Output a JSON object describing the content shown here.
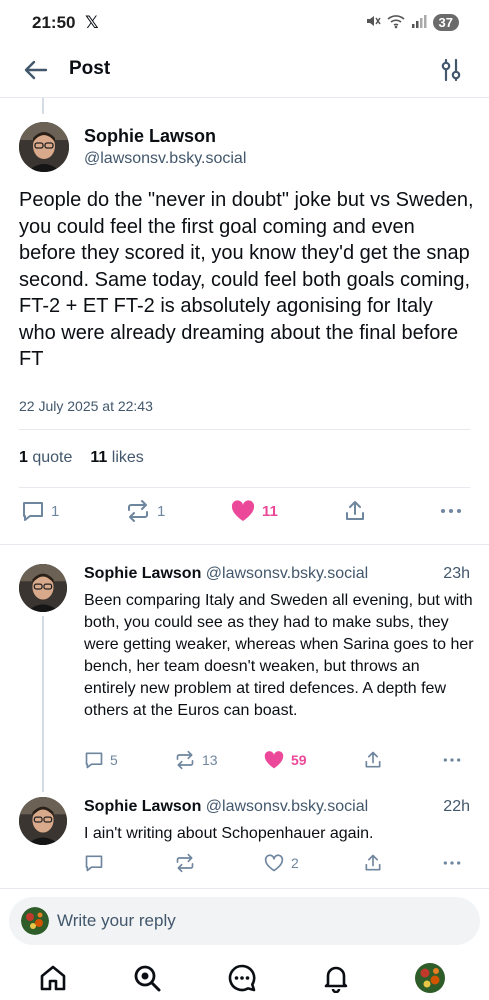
{
  "status_bar": {
    "time": "21:50",
    "app_glyph": "𝕏",
    "battery": "37"
  },
  "header": {
    "title": "Post"
  },
  "main_post": {
    "author": "Sophie Lawson",
    "handle": "@lawsonsv.bsky.social",
    "text": "People do the \"never in doubt\" joke but vs Sweden, you could feel the first goal coming and even before they scored it, you know they'd get the snap second. Same today, could feel both goals coming, FT-2 + ET FT-2 is absolutely agonising for Italy who were already dreaming about the final before FT",
    "date": "22 July 2025 at 22:43",
    "quotes_count": "1",
    "quotes_label": "quote",
    "likes_count": "11",
    "likes_label": "likes",
    "actions": {
      "replies": "1",
      "reposts": "1",
      "likes": "11"
    }
  },
  "replies": [
    {
      "author": "Sophie Lawson",
      "handle": "@lawsonsv.bsky.social",
      "time": "23h",
      "text": "Been comparing Italy and Sweden all evening, but with both, you could see as they had to make subs, they were getting weaker, whereas when Sarina goes to her bench, her team doesn't weaken, but throws an entirely new problem at tired defences. A depth few others at the Euros can boast.",
      "replies": "5",
      "reposts": "13",
      "likes": "59",
      "liked": true
    },
    {
      "author": "Sophie Lawson",
      "handle": "@lawsonsv.bsky.social",
      "time": "22h",
      "text": "I ain't writing about Schopenhauer again.",
      "replies": "",
      "reposts": "",
      "likes": "2",
      "liked": false
    }
  ],
  "composer": {
    "placeholder": "Write your reply"
  },
  "nav": [
    "home-icon",
    "search-icon",
    "chat-icon",
    "notifications-icon",
    "profile-avatar"
  ],
  "colors": {
    "accent_like": "#ec4899",
    "muted": "#6f869f",
    "text": "#0b0f14",
    "handle": "#42576c"
  }
}
